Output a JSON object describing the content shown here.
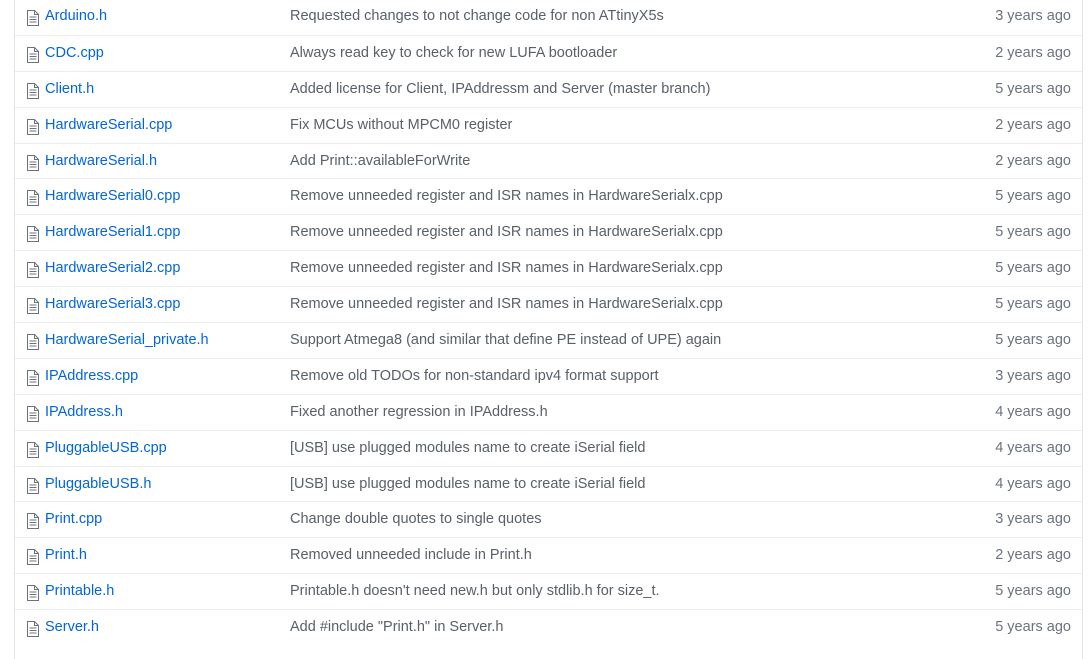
{
  "files": [
    {
      "name": "Arduino.h",
      "message": "Requested changes to not change code for non ATtinyX5s",
      "age": "3 years ago"
    },
    {
      "name": "CDC.cpp",
      "message": "Always read key to check for new LUFA bootloader",
      "age": "2 years ago"
    },
    {
      "name": "Client.h",
      "message": "Added license for Client, IPAddressm and Server (master branch)",
      "age": "5 years ago"
    },
    {
      "name": "HardwareSerial.cpp",
      "message": "Fix MCUs without MPCM0 register",
      "age": "2 years ago"
    },
    {
      "name": "HardwareSerial.h",
      "message": "Add Print::availableForWrite",
      "age": "2 years ago"
    },
    {
      "name": "HardwareSerial0.cpp",
      "message": "Remove unneeded register and ISR names in HardwareSerialx.cpp",
      "age": "5 years ago"
    },
    {
      "name": "HardwareSerial1.cpp",
      "message": "Remove unneeded register and ISR names in HardwareSerialx.cpp",
      "age": "5 years ago"
    },
    {
      "name": "HardwareSerial2.cpp",
      "message": "Remove unneeded register and ISR names in HardwareSerialx.cpp",
      "age": "5 years ago"
    },
    {
      "name": "HardwareSerial3.cpp",
      "message": "Remove unneeded register and ISR names in HardwareSerialx.cpp",
      "age": "5 years ago"
    },
    {
      "name": "HardwareSerial_private.h",
      "message": "Support Atmega8 (and similar that define PE instead of UPE) again",
      "age": "5 years ago"
    },
    {
      "name": "IPAddress.cpp",
      "message": "Remove old TODOs for non-standard ipv4 format support",
      "age": "3 years ago"
    },
    {
      "name": "IPAddress.h",
      "message": "Fixed another regression in IPAddress.h",
      "age": "4 years ago"
    },
    {
      "name": "PluggableUSB.cpp",
      "message": "[USB] use plugged modules name to create iSerial field",
      "age": "4 years ago"
    },
    {
      "name": "PluggableUSB.h",
      "message": "[USB] use plugged modules name to create iSerial field",
      "age": "4 years ago"
    },
    {
      "name": "Print.cpp",
      "message": "Change double quotes to single quotes",
      "age": "3 years ago"
    },
    {
      "name": "Print.h",
      "message": "Removed unneeded include in Print.h",
      "age": "2 years ago"
    },
    {
      "name": "Printable.h",
      "message": "Printable.h doesn't need new.h but only stdlib.h for size_t.",
      "age": "5 years ago"
    },
    {
      "name": "Server.h",
      "message": "Add #include \"Print.h\" in Server.h",
      "age": "5 years ago"
    }
  ],
  "icon": "file-icon",
  "colors": {
    "link": "#0366d6",
    "message": "#586069",
    "age": "#6a737d",
    "border": "#eaecef"
  }
}
